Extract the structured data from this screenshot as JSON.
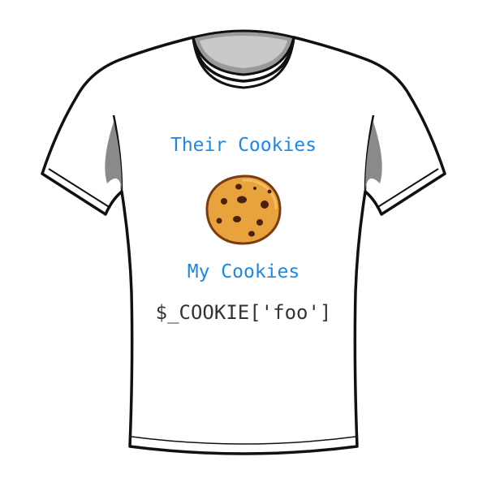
{
  "shirt_print": {
    "top_text": "Their Cookies",
    "bottom_text": "My Cookies",
    "code_text": "$_COOKIE['foo']"
  },
  "colors": {
    "heading_text": "#1e88e5",
    "code_text": "#333333",
    "shirt_outline": "#111111",
    "shirt_fill": "#ffffff",
    "cookie_dough": "#e8a33c",
    "cookie_edge": "#7a3b10",
    "chocolate_chips": "#4a2210"
  },
  "icons": {
    "shirt": "tshirt-graphic",
    "cookie": "cookie-icon"
  }
}
